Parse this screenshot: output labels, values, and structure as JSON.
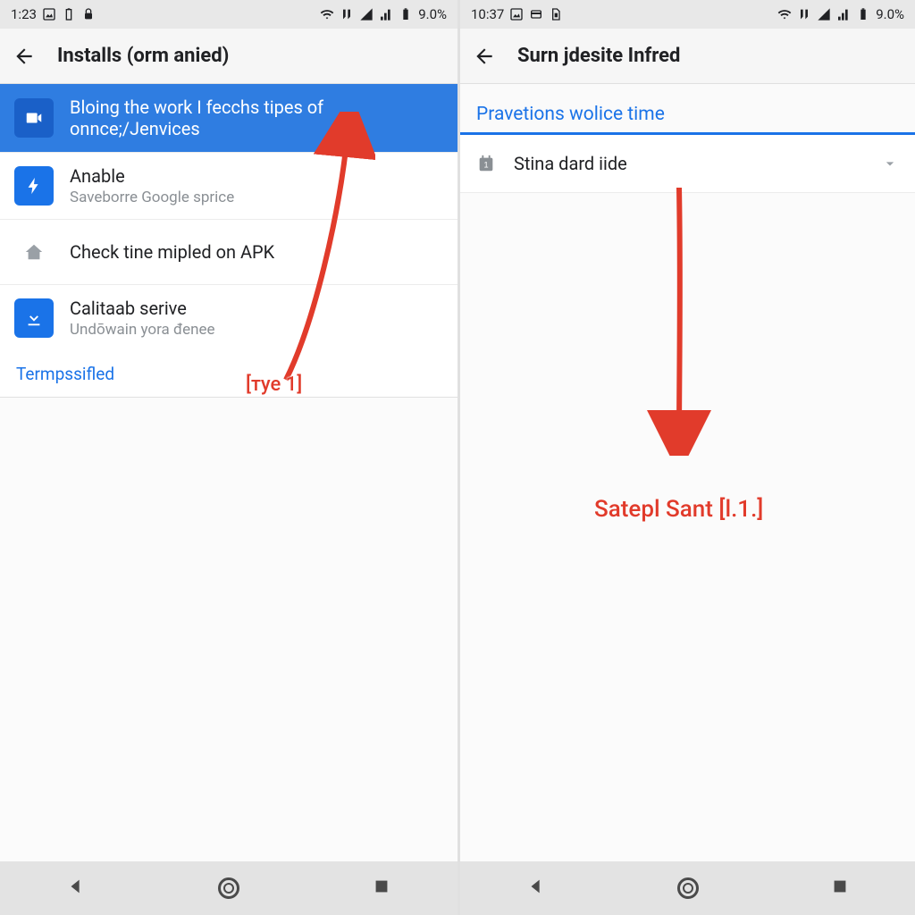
{
  "left": {
    "status": {
      "time": "1:23",
      "battery": "9.0%"
    },
    "appbar": {
      "title": "Installs  (orm anied)"
    },
    "items": [
      {
        "icon": "video",
        "title": "Bloing the work I fecchs tipes of onnce;/Jenvices",
        "sub": "",
        "selected": true
      },
      {
        "icon": "bolt",
        "title": "Anable",
        "sub": "Saveborre Google sprice"
      },
      {
        "icon": "home-grey",
        "title": "Check tine mipled on APK",
        "sub": ""
      },
      {
        "icon": "download",
        "title": "Calitaab serive",
        "sub": "Undōwain yora đenee"
      }
    ],
    "footer_link": "Termpssifled",
    "annotation": "[тye 1]"
  },
  "right": {
    "status": {
      "time": "10:37",
      "battery": "9.0%"
    },
    "appbar": {
      "title": "Surn jdesite Infred"
    },
    "section_header": "Pravetions wolice time",
    "row": {
      "label": "Stina dard iide"
    },
    "annotation": "Satepl Sant [l.1.]"
  },
  "colors": {
    "accent": "#1a73e8",
    "anno": "#e13b2b"
  }
}
